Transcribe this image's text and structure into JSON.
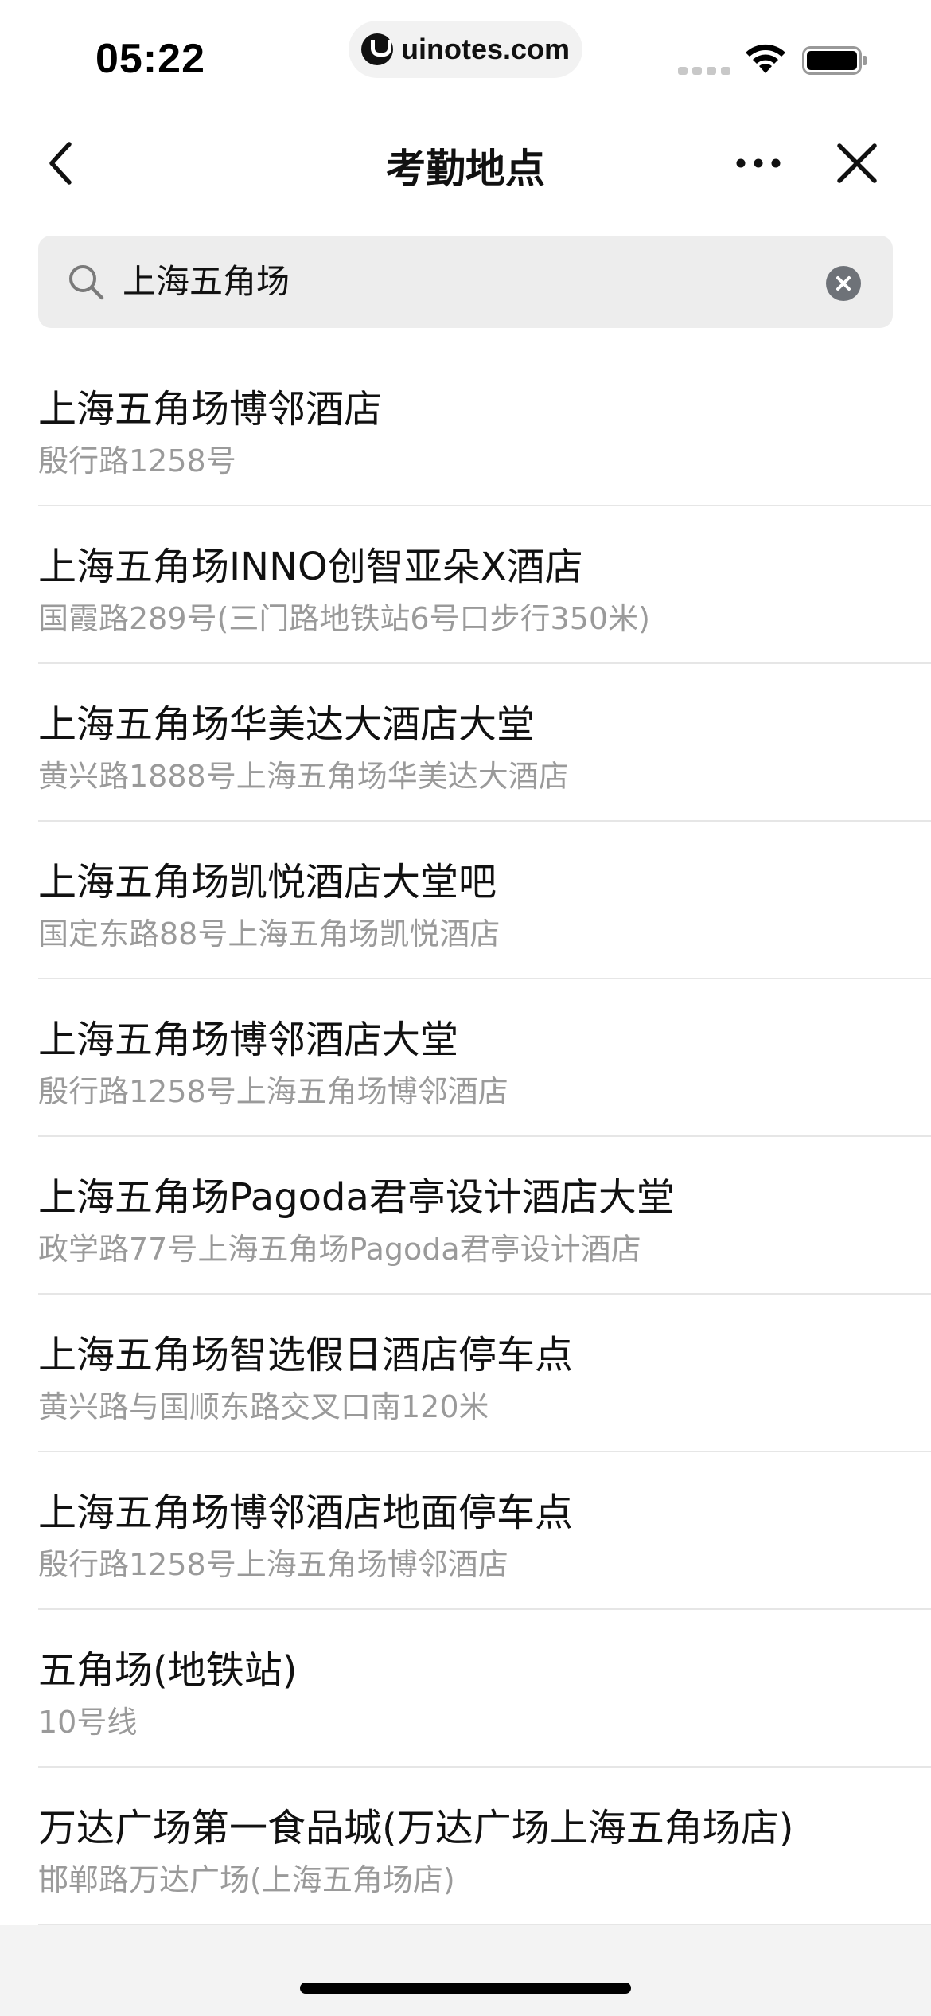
{
  "status_bar": {
    "time": "05:22",
    "url": "uinotes.com"
  },
  "nav": {
    "title": "考勤地点"
  },
  "search": {
    "value": "上海五角场"
  },
  "results": [
    {
      "name": "上海五角场博邻酒店",
      "address": "殷行路1258号"
    },
    {
      "name": "上海五角场INNO创智亚朵X酒店",
      "address": "国霞路289号(三门路地铁站6号口步行350米)"
    },
    {
      "name": "上海五角场华美达大酒店大堂",
      "address": "黄兴路1888号上海五角场华美达大酒店"
    },
    {
      "name": "上海五角场凯悦酒店大堂吧",
      "address": "国定东路88号上海五角场凯悦酒店"
    },
    {
      "name": "上海五角场博邻酒店大堂",
      "address": "殷行路1258号上海五角场博邻酒店"
    },
    {
      "name": "上海五角场Pagoda君亭设计酒店大堂",
      "address": "政学路77号上海五角场Pagoda君亭设计酒店"
    },
    {
      "name": "上海五角场智选假日酒店停车点",
      "address": "黄兴路与国顺东路交叉口南120米"
    },
    {
      "name": "上海五角场博邻酒店地面停车点",
      "address": "殷行路1258号上海五角场博邻酒店"
    },
    {
      "name": "五角场(地铁站)",
      "address": "10号线"
    },
    {
      "name": "万达广场第一食品城(万达广场上海五角场店)",
      "address": "邯郸路万达广场(上海五角场店)"
    }
  ],
  "icons": {
    "back": "chevron-left-icon",
    "more": "more-dots-icon",
    "close": "close-icon",
    "search": "search-icon",
    "clear": "clear-circle-icon",
    "wifi": "wifi-icon",
    "battery": "battery-icon",
    "signal": "cellular-signal-icon"
  },
  "colors": {
    "primary_text": "#111111",
    "secondary_text": "#9a9a9a",
    "search_bg": "#ededed",
    "divider": "#e6e6e6"
  }
}
